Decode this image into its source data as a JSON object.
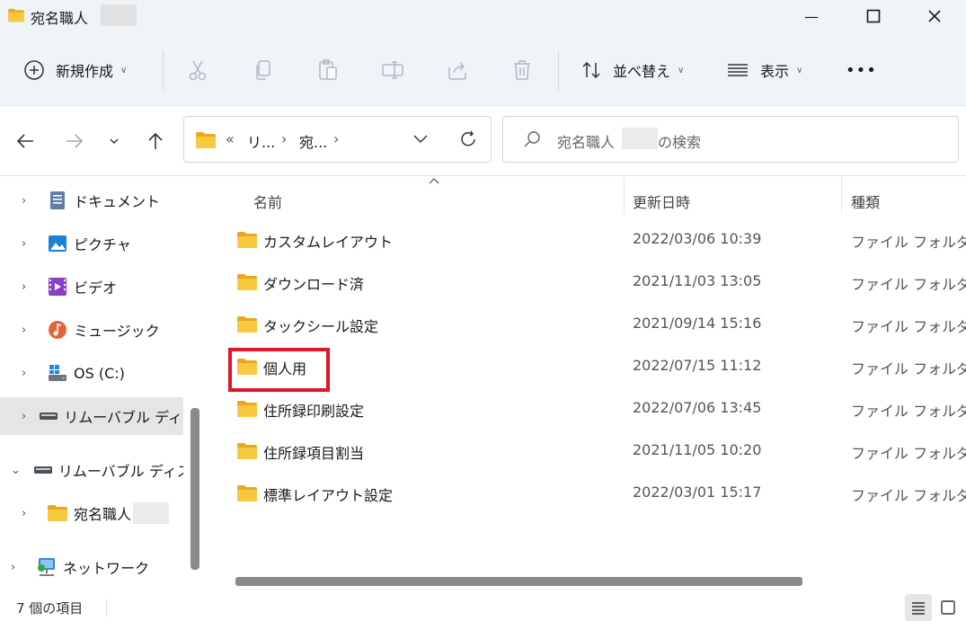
{
  "window": {
    "title": "宛名職人",
    "minimize_glyph": "—",
    "maximize_glyph": "☐",
    "close_glyph": "✕"
  },
  "toolbar": {
    "new_label": "新規作成",
    "sort_label": "並べ替え",
    "view_label": "表示",
    "more_glyph": "•••"
  },
  "address": {
    "prefix": "«",
    "crumb1": "リ...",
    "sep": "›",
    "crumb2": "宛...",
    "search_placeholder_pre": "宛名職人",
    "search_placeholder_post": "の検索"
  },
  "sidebar": {
    "items": [
      {
        "label": "ドキュメント",
        "icon": "document-icon"
      },
      {
        "label": "ピクチャ",
        "icon": "pictures-icon"
      },
      {
        "label": "ビデオ",
        "icon": "video-icon"
      },
      {
        "label": "ミュージック",
        "icon": "music-icon"
      },
      {
        "label": "OS (C:)",
        "icon": "drive-icon"
      },
      {
        "label": "リムーバブル ディスク",
        "icon": "removable-drive-icon"
      },
      {
        "label": "リムーバブル ディスク",
        "icon": "removable-drive-icon"
      },
      {
        "label": "宛名職人",
        "icon": "folder-icon"
      },
      {
        "label": "ネットワーク",
        "icon": "network-icon"
      }
    ]
  },
  "columns": {
    "name": "名前",
    "date": "更新日時",
    "type": "種類"
  },
  "files": [
    {
      "name": "カスタムレイアウト",
      "date": "2022/03/06 10:39",
      "type": "ファイル フォルダー"
    },
    {
      "name": "ダウンロード済",
      "date": "2021/11/03 13:05",
      "type": "ファイル フォルダー"
    },
    {
      "name": "タックシール設定",
      "date": "2021/09/14 15:16",
      "type": "ファイル フォルダー"
    },
    {
      "name": "個人用",
      "date": "2022/07/15 11:12",
      "type": "ファイル フォルダー"
    },
    {
      "name": "住所録印刷設定",
      "date": "2022/07/06 13:45",
      "type": "ファイル フォルダー"
    },
    {
      "name": "住所録項目割当",
      "date": "2021/11/05 10:20",
      "type": "ファイル フォルダー"
    },
    {
      "name": "標準レイアウト設定",
      "date": "2022/03/01 15:17",
      "type": "ファイル フォルダー"
    }
  ],
  "status": {
    "item_count": "7 個の項目"
  },
  "colors": {
    "folder": "#f8c93e",
    "highlight": "#e0142a",
    "chrome": "#eff4f9"
  }
}
